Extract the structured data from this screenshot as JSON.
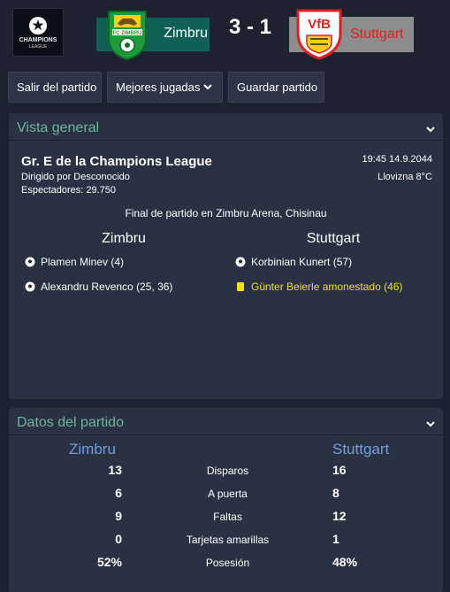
{
  "header": {
    "competition_logo_text": "CHAMPIONS",
    "competition_logo_sub": "LEAGUE",
    "home_team": "Zimbru",
    "away_team": "Stuttgart",
    "score": "3 - 1",
    "home_crest_text": "FC ZIMBRU",
    "away_crest_text": "VfB"
  },
  "toolbar": {
    "exit_label": "Salir del partido",
    "highlights_label": "Mejores jugadas",
    "save_label": "Guardar partido"
  },
  "overview": {
    "title": "Vista general",
    "match_title": "Gr. E de la Champions League",
    "referee": "Dirigido por Desconocido",
    "attendance": "Espectadores: 29.750",
    "datetime": "19:45 14.9.2044",
    "weather": "Llovizna 8°C",
    "summary": "Final de partido en Zimbru Arena, Chisinau",
    "home_team": "Zimbru",
    "away_team": "Stuttgart",
    "home_events": [
      {
        "text": "Plamen Minev (4)"
      },
      {
        "text": "Alexandru Revenco (25, 36)"
      }
    ],
    "away_events": [
      {
        "text": "Korbinian Kunert (57)"
      },
      {
        "text": "Günter Beierle amonestado (46)"
      }
    ]
  },
  "stats": {
    "title": "Datos del partido",
    "home_team": "Zimbru",
    "away_team": "Stuttgart",
    "rows": [
      {
        "label": "Disparos",
        "home": "13",
        "away": "16"
      },
      {
        "label": "A puerta",
        "home": "6",
        "away": "8"
      },
      {
        "label": "Faltas",
        "home": "9",
        "away": "12"
      },
      {
        "label": "Tarjetas amarillas",
        "home": "0",
        "away": "1"
      },
      {
        "label": "Posesión",
        "home": "52%",
        "away": "48%"
      }
    ]
  },
  "colors": {
    "background": "#1e2230",
    "panel": "#2a3142",
    "accent_green": "#6fb59a",
    "accent_blue": "#6f9fe0",
    "home_bar": "#0f6156",
    "away_bar": "#8d8d8d",
    "away_red": "#e02020",
    "yellow": "#f0e020"
  },
  "icons": {
    "competition": "champions-league-starball",
    "goal": "football-icon",
    "booking": "yellow-card-icon",
    "dropdown": "chevron-down-icon"
  }
}
